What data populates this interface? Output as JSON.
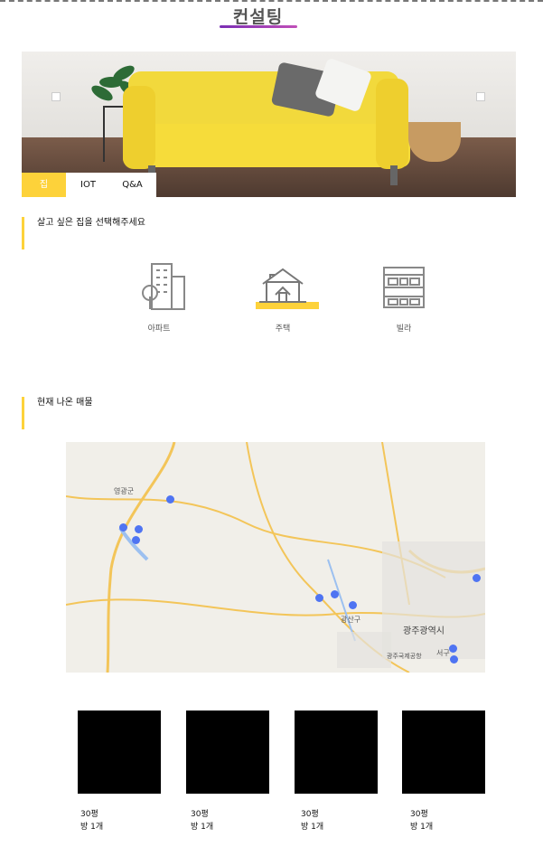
{
  "page": {
    "title": "컨설팅"
  },
  "hero": {
    "tabs": [
      {
        "label": "집",
        "active": true
      },
      {
        "label": "IOT",
        "active": false
      },
      {
        "label": "Q&A",
        "active": false
      }
    ]
  },
  "section_select": {
    "label": "살고 싶은 집을 선택해주세요"
  },
  "house_types": [
    {
      "label": "아파트",
      "icon": "apartment-icon"
    },
    {
      "label": "주택",
      "icon": "house-icon",
      "selected": true
    },
    {
      "label": "빌라",
      "icon": "villa-icon"
    }
  ],
  "section_listings": {
    "label": "현재 나온 매물"
  },
  "map": {
    "labels": [
      {
        "text": "영광군"
      },
      {
        "text": "광산구"
      },
      {
        "text": "광주광역시"
      },
      {
        "text": "서구"
      },
      {
        "text": "광주국제공항"
      }
    ]
  },
  "listings": [
    {
      "size": "30평",
      "rooms": "방 1개"
    },
    {
      "size": "30평",
      "rooms": "방 1개"
    },
    {
      "size": "30평",
      "rooms": "방 1개"
    },
    {
      "size": "30평",
      "rooms": "방 1개"
    }
  ],
  "colors": {
    "accent": "#fdd23a",
    "title_underline": "#9b3fb8",
    "map_marker": "#4f74f2"
  }
}
